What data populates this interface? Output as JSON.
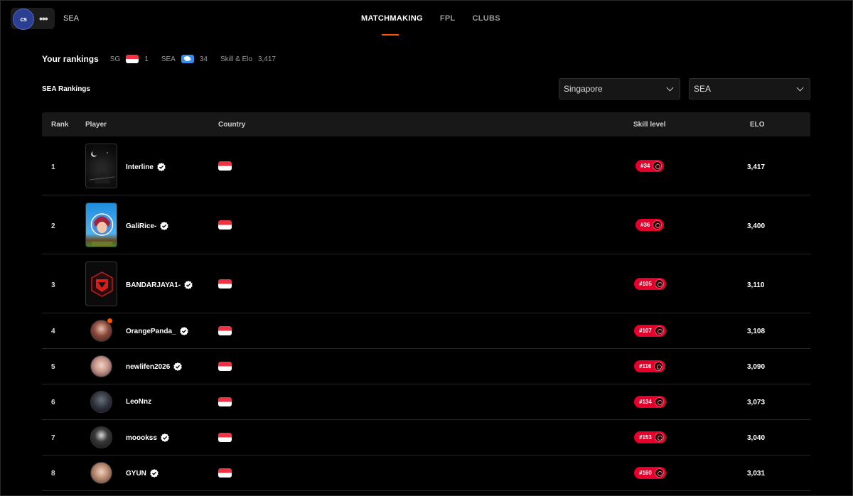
{
  "header": {
    "game_logo_text": "cs",
    "region": "SEA",
    "nav_tabs": [
      {
        "label": "MATCHMAKING",
        "active": true
      },
      {
        "label": "FPL",
        "active": false
      },
      {
        "label": "CLUBS",
        "active": false
      }
    ],
    "accent_color": "#ff5500"
  },
  "your_rankings": {
    "title": "Your rankings",
    "sg_label": "SG",
    "sg_value": "1",
    "sea_label": "SEA",
    "sea_value": "34",
    "skill_label": "Skill & Elo",
    "skill_value": "3,417"
  },
  "rankings": {
    "title": "SEA Rankings",
    "country_select": "Singapore",
    "region_select": "SEA",
    "columns": {
      "rank": "Rank",
      "player": "Player",
      "country": "Country",
      "skill": "Skill level",
      "elo": "ELO"
    },
    "rows": [
      {
        "rank": "1",
        "name": "Interline",
        "skill": "#34",
        "elo": "3,417"
      },
      {
        "rank": "2",
        "name": "GaliRice-",
        "skill": "#36",
        "elo": "3,400"
      },
      {
        "rank": "3",
        "name": "BANDARJAYA1-",
        "skill": "#105",
        "elo": "3,110"
      },
      {
        "rank": "4",
        "name": "OrangePanda_",
        "skill": "#107",
        "elo": "3,108"
      },
      {
        "rank": "5",
        "name": "newlifen2026",
        "skill": "#116",
        "elo": "3,090"
      },
      {
        "rank": "6",
        "name": "LeoNnz",
        "skill": "#134",
        "elo": "3,073"
      },
      {
        "rank": "7",
        "name": "moookss",
        "skill": "#153",
        "elo": "3,040"
      },
      {
        "rank": "8",
        "name": "GYUN",
        "skill": "#160",
        "elo": "3,031"
      }
    ],
    "skill_badge_color": "#e4002b"
  }
}
